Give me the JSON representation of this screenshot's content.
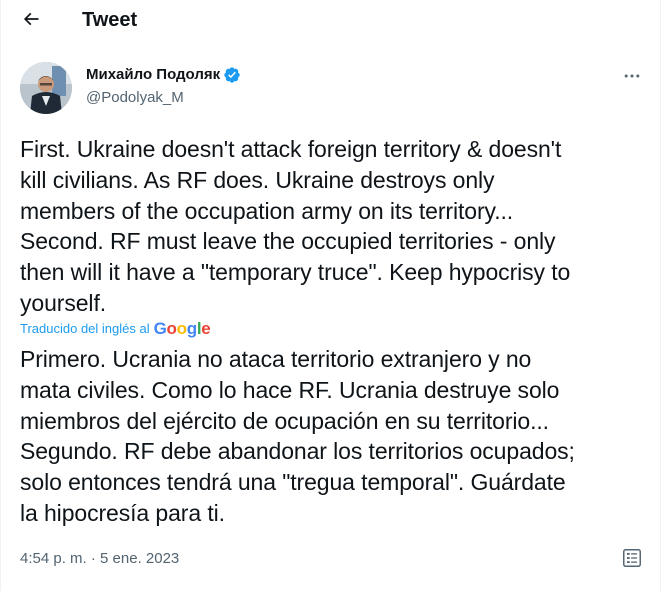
{
  "header": {
    "back_icon": "arrow-left-icon",
    "title": "Tweet"
  },
  "author": {
    "display_name": "Михайло Подоляк",
    "handle": "@Podolyak_M",
    "verified_icon": "verified-badge-icon",
    "accent_color": "#1d9bf0"
  },
  "tweet": {
    "text": "First. Ukraine doesn't attack foreign territory & doesn't\nkill civilians. As RF does. Ukraine destroys only\nmembers of the occupation army on its territory...\nSecond. RF must leave the occupied territories - only\nthen will it have a \"temporary truce\". Keep hypocrisy to\nyourself.",
    "translated_label": "Traducido del inglés al",
    "translator_brand": "Google",
    "translation": "Primero. Ucrania no ataca territorio extranjero y no\nmata civiles. Como lo hace RF. Ucrania destruye solo\nmiembros del ejército de ocupación en su territorio...\nSegundo. RF debe abandonar los territorios ocupados;\nsolo entonces tendrá una \"tregua temporal\". Guárdate\nla hipocresía para ti.",
    "timestamp": "4:54 p. m. · 5 ene. 2023",
    "more_icon": "more-icon",
    "analytics_icon": "analytics-icon"
  }
}
